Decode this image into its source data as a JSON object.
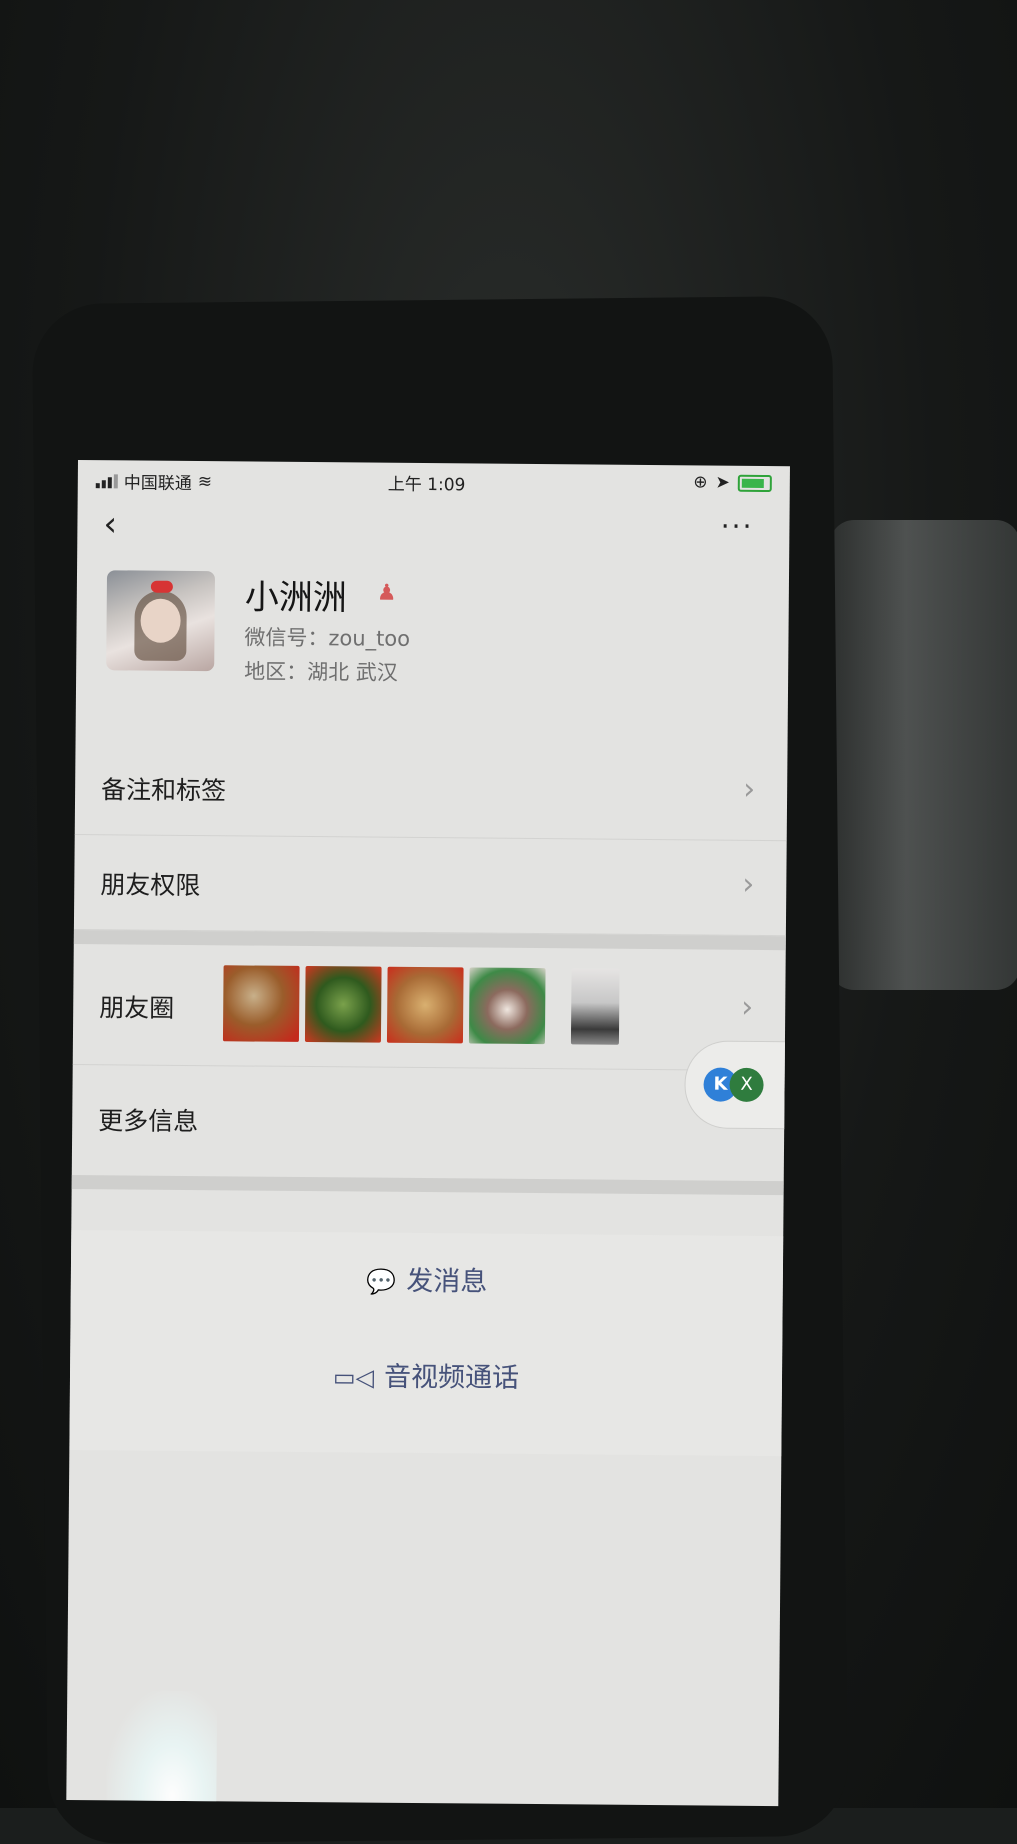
{
  "status_bar": {
    "carrier": "中国联通",
    "time": "上午 1:09"
  },
  "nav": {
    "back_icon": "chevron-left-icon",
    "more_icon": "ellipsis-icon",
    "more_label": "···"
  },
  "profile": {
    "name": "小洲洲",
    "gender_icon": "female-person-icon",
    "wechat_id": "微信号：zou_too",
    "region": "地区：湖北 武汉"
  },
  "list": {
    "remark_tags": "备注和标签",
    "friend_permissions": "朋友权限",
    "moments": "朋友圈",
    "more_info": "更多信息"
  },
  "floating": {
    "k_label": "K",
    "x_label": "X"
  },
  "actions": {
    "send_message": "发消息",
    "video_call": "音视频通话"
  },
  "colors": {
    "action_text": "#46527a",
    "screen_bg": "#e3e3e1",
    "battery_green": "#39b54a"
  }
}
